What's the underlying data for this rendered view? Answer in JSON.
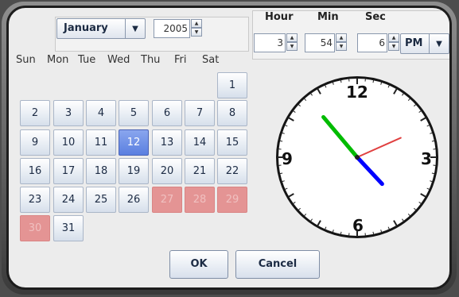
{
  "date": {
    "month": "January",
    "year": "2005",
    "weekdays": [
      "Sun",
      "Mon",
      "Tue",
      "Wed",
      "Thu",
      "Fri",
      "Sat"
    ],
    "days": [
      "1",
      "2",
      "3",
      "4",
      "5",
      "6",
      "7",
      "8",
      "9",
      "10",
      "11",
      "12",
      "13",
      "14",
      "15",
      "16",
      "17",
      "18",
      "19",
      "20",
      "21",
      "22",
      "23",
      "24",
      "25",
      "26",
      "27",
      "28",
      "29",
      "30",
      "31"
    ],
    "selected_day": "12",
    "disabled_days": [
      "27",
      "28",
      "29",
      "30"
    ]
  },
  "time": {
    "hour_label": "Hour",
    "min_label": "Min",
    "sec_label": "Sec",
    "hour": "3",
    "min": "54",
    "sec": "6",
    "ampm": "PM"
  },
  "clock": {
    "numbers": [
      "12",
      "3",
      "6",
      "9"
    ],
    "hand_colors": {
      "hour": "#0000ff",
      "minute": "#00bb00",
      "second": "#e04040"
    }
  },
  "buttons": {
    "ok": "OK",
    "cancel": "Cancel"
  }
}
